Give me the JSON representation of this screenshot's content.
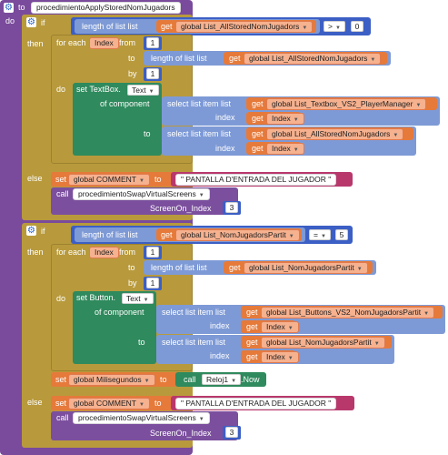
{
  "procedure": {
    "to_label": "to",
    "name": "procedimientoApplyStoredNomJugadors",
    "do_label": "do"
  },
  "kw": {
    "if": "if",
    "then": "then",
    "else": "else",
    "for_each": "for each",
    "from": "from",
    "to": "to",
    "by": "by",
    "do": "do",
    "length_of_list": "length of list  list",
    "get": "get",
    "select_list_item": "select list item  list",
    "index": "index",
    "of_component": "of component",
    "set": "set",
    "call": "call",
    "screen_on_index": "ScreenOn_Index",
    "now": ".Now"
  },
  "block1": {
    "if_list": "global List_AllStoredNomJugadors",
    "op": ">",
    "compare_value": "0",
    "loop_var": "Index",
    "from_value": "1",
    "to_list": "global List_AllStoredNomJugadors",
    "by_value": "1",
    "set_target": "set TextBox.",
    "set_prop": "Text",
    "sel1_list": "global List_Textbox_VS2_PlayerManager",
    "sel1_index": "Index",
    "sel2_list": "global List_AllStoredNomJugadors",
    "sel2_index": "Index",
    "else_var": "global COMMENT",
    "else_text": "\" PANTALLA D'ENTRADA DEL JUGADOR \"",
    "call_proc": "procedimientoSwapVirtualScreens",
    "screen_value": "3"
  },
  "block2": {
    "if_list": "global List_NomJugadorsPartit",
    "op": "=",
    "compare_value": "5",
    "loop_var": "Index",
    "from_value": "1",
    "to_list": "global List_NomJugadorsPartit",
    "by_value": "1",
    "set_target": "set Button.",
    "set_prop": "Text",
    "sel1_list": "global List_Buttons_VS2_NomJugadorsPartit",
    "sel1_index": "Index",
    "sel2_list": "global List_NomJugadorsPartit",
    "sel2_index": "Index",
    "mili_var": "global Milisegundos",
    "clock": "Reloj1",
    "else_var": "global COMMENT",
    "else_text": "\" PANTALLA D'ENTRADA DEL JUGADOR \"",
    "call_proc": "procedimientoSwapVirtualScreens",
    "screen_value": "3"
  },
  "colors": {
    "procedure": "#7a4a9c",
    "control": "#b89a3c",
    "math": "#3c5fc5",
    "lists": "#7e9ad6",
    "variables": "#e57a3a",
    "components": "#2f8a5d",
    "text": "#b8386c"
  }
}
